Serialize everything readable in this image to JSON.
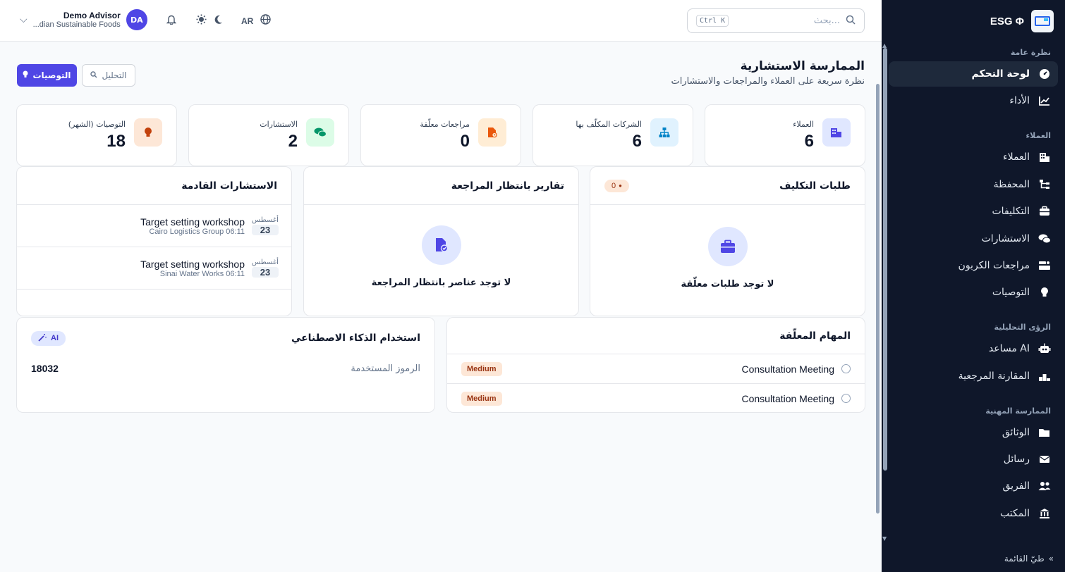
{
  "sidebar": {
    "brand": "ESG Φ",
    "sections": [
      "نظرة عامة",
      "العملاء",
      "الرؤى التحليلية",
      "الممارسة المهنية"
    ],
    "items": [
      {
        "label": "لوحة التحكم",
        "icon": "dashboard-icon"
      },
      {
        "label": "الأداء",
        "icon": "chart-line-icon"
      },
      {
        "label": "العملاء",
        "icon": "building-icon"
      },
      {
        "label": "المحفظة",
        "icon": "sitemap-icon"
      },
      {
        "label": "التكليفات",
        "icon": "briefcase-icon"
      },
      {
        "label": "الاستشارات",
        "icon": "chat-icon"
      },
      {
        "label": "مراجعات الكربون",
        "icon": "carbon-icon"
      },
      {
        "label": "التوصيات",
        "icon": "lightbulb-icon"
      },
      {
        "label": "مساعد AI",
        "icon": "robot-icon"
      },
      {
        "label": "المقارنة المرجعية",
        "icon": "benchmark-icon"
      },
      {
        "label": "الوثائق",
        "icon": "folder-icon"
      },
      {
        "label": "رسائل",
        "icon": "envelope-icon"
      },
      {
        "label": "الفريق",
        "icon": "users-icon"
      },
      {
        "label": "المكتب",
        "icon": "bank-icon"
      }
    ],
    "collapse": "طيّ القائمة"
  },
  "topbar": {
    "search_placeholder": "بحث...",
    "shortcut": "Ctrl K",
    "lang": "AR",
    "user_name": "Demo Advisor",
    "user_org": "...dian Sustainable Foods",
    "avatar": "DA"
  },
  "header": {
    "title": "الممارسة الاستشارية",
    "subtitle": "نظرة سريعة على العملاء والمراجعات والاستشارات",
    "btn_recommendations": "التوصيات",
    "btn_analysis": "التحليل"
  },
  "stats": [
    {
      "label": "العملاء",
      "value": "6",
      "color": "#e0e7ff",
      "icon_color": "#4f46e5"
    },
    {
      "label": "الشركات المكلّف بها",
      "value": "6",
      "color": "#e0f2fe",
      "icon_color": "#0284c7"
    },
    {
      "label": "مراجعات معلّقة",
      "value": "0",
      "color": "#ffedd5",
      "icon_color": "#ea580c"
    },
    {
      "label": "الاستشارات",
      "value": "2",
      "color": "#dcfce7",
      "icon_color": "#059669"
    },
    {
      "label": "التوصيات (الشهر)",
      "value": "18",
      "color": "#ffedd5",
      "icon_color": "#c2410c"
    }
  ],
  "engagements": {
    "title": "طلبات التكليف",
    "count": "0",
    "empty": "لا توجد طلبات معلّقة"
  },
  "reports": {
    "title": "تقارير بانتظار المراجعة",
    "empty": "لا توجد عناصر بانتظار المراجعة"
  },
  "consultations": {
    "title": "الاستشارات القادمة",
    "items": [
      {
        "month": "أغسطس",
        "day": "23",
        "title": "Target setting workshop",
        "sub": "Cairo Logistics Group 06:11"
      },
      {
        "month": "أغسطس",
        "day": "23",
        "title": "Target setting workshop",
        "sub": "Sinai Water Works 06:11"
      }
    ]
  },
  "tasks": {
    "title": "المهام المعلّقة",
    "items": [
      {
        "title": "Consultation Meeting",
        "priority": "Medium"
      },
      {
        "title": "Consultation Meeting",
        "priority": "Medium"
      }
    ]
  },
  "ai_usage": {
    "title": "استخدام الذكاء الاصطناعي",
    "badge": "AI",
    "label": "الرموز المستخدمة",
    "value": "18032"
  }
}
